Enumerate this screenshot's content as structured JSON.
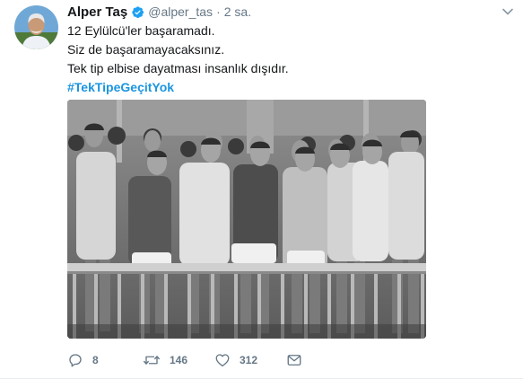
{
  "tweet": {
    "author_name": "Alper Taş",
    "handle": "@alper_tas",
    "separator": "·",
    "time": "2 sa.",
    "lines": [
      "12 Eylülcü'ler başaramadı.",
      "Siz de başaramayacaksınız.",
      "Tek tip elbise dayatması insanlık dışıdır."
    ],
    "hashtag": "#TekTipeGeçitYok"
  },
  "actions": {
    "reply_count": "8",
    "retweet_count": "146",
    "like_count": "312"
  },
  "colors": {
    "link": "#1b95e0",
    "muted": "#657786",
    "verified": "#1da1f2",
    "text": "#14171a"
  },
  "icons": {
    "verified": "verified-badge-icon",
    "menu": "chevron-down-icon",
    "reply": "reply-icon",
    "retweet": "retweet-icon",
    "like": "heart-icon",
    "dm": "envelope-icon"
  }
}
